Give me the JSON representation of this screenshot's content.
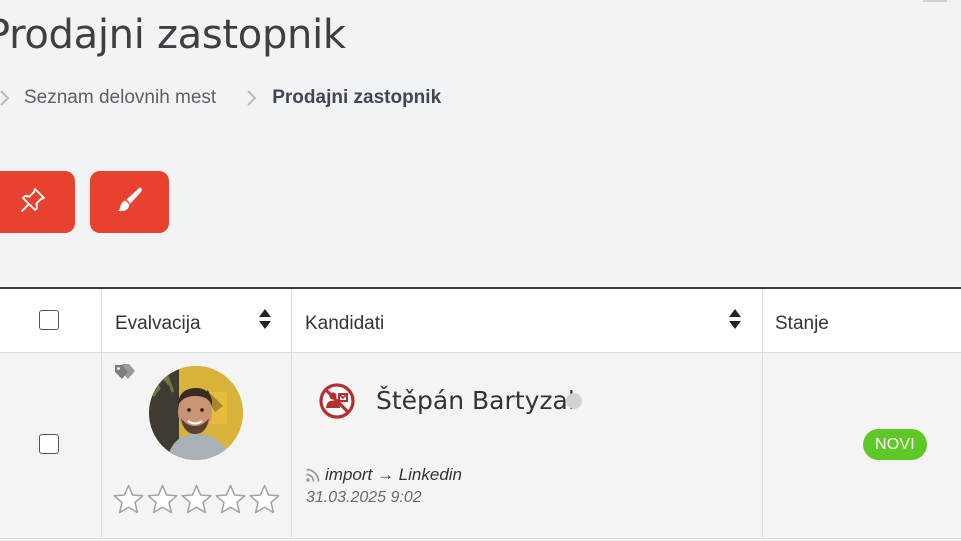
{
  "page": {
    "title": "Prodajni zastopnik"
  },
  "breadcrumb": {
    "items": [
      "Seznam delovnih mest",
      "Prodajni zastopnik"
    ]
  },
  "actions": {
    "pin_icon": "pin-icon",
    "brush_icon": "brush-icon",
    "button_color": "#e8412f"
  },
  "table": {
    "headers": {
      "evaluation": "Evalvacija",
      "candidates": "Kandidati",
      "status": "Stanje"
    },
    "rows": [
      {
        "selected": false,
        "tag_icon": "tag-icon",
        "rating": 0,
        "rating_max": 5,
        "contact_icon": "no-contact-icon",
        "name": "Štěpán Bartyzal",
        "source": "import → Linkedin",
        "date": "31.03.2025 9:02",
        "status": "NOVI",
        "status_color": "#5ec926"
      }
    ]
  }
}
